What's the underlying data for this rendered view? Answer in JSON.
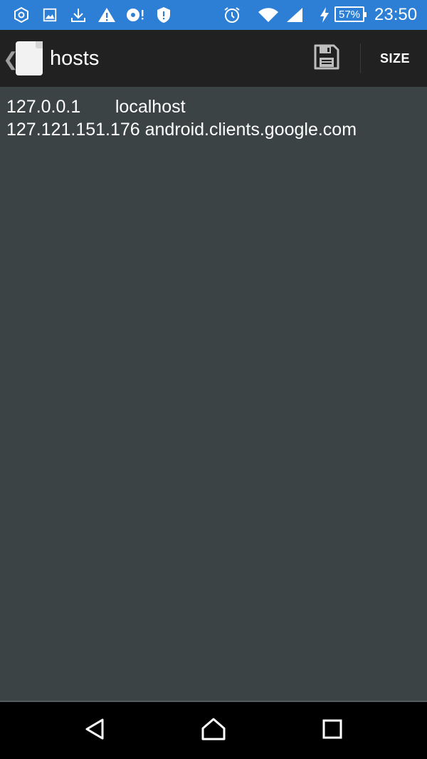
{
  "status_bar": {
    "icons_left": [
      "hexagon-icon",
      "image-icon",
      "download-icon",
      "warning-icon",
      "disc-icon",
      "shield-icon"
    ],
    "icons_right": [
      "alarm-icon",
      "wifi-icon",
      "signal-icon",
      "charging-icon"
    ],
    "battery": "57%",
    "time": "23:50",
    "color": "#2d7fd6"
  },
  "toolbar": {
    "title": "hosts",
    "save_icon": "save-icon",
    "size_label": "SIZE"
  },
  "editor": {
    "lines": [
      "127.0.0.1       localhost",
      "127.121.151.176 android.clients.google.com"
    ]
  },
  "nav_bar": {
    "icons": [
      "back-icon",
      "home-icon",
      "recents-icon"
    ]
  }
}
